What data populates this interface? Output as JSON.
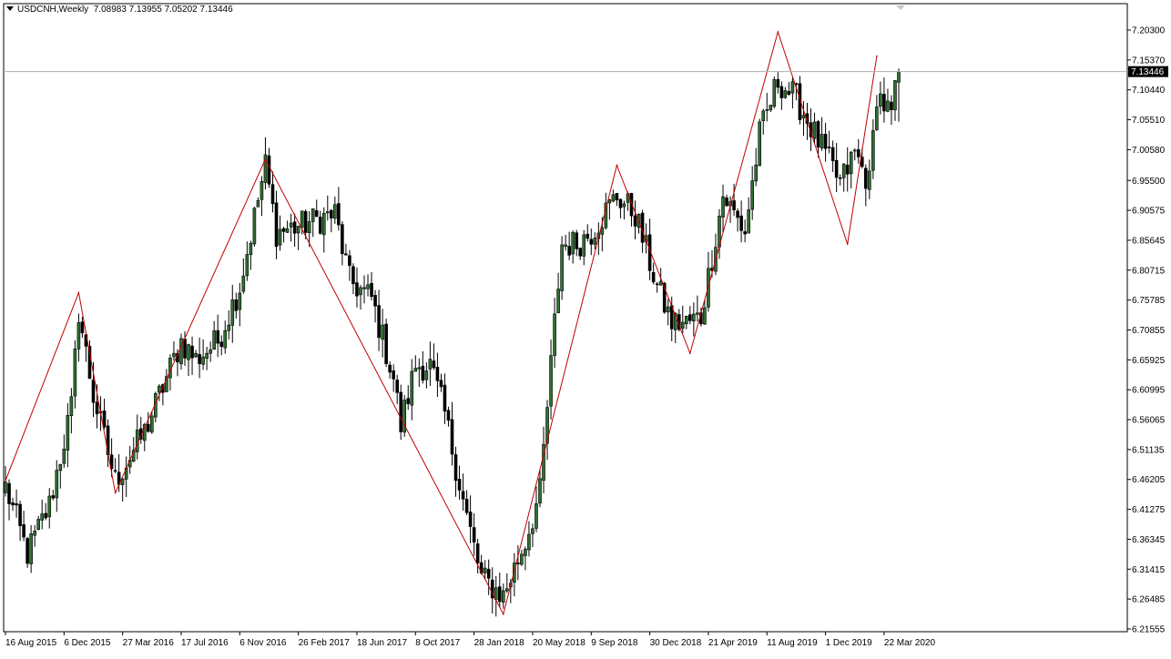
{
  "header": {
    "symbol_timeframe": "USDCNH,Weekly",
    "ohlc": "7.08983 7.13955 7.05202 7.13446"
  },
  "colors": {
    "bull_fill": "#2f6f2f",
    "bear_fill": "#000000",
    "zigzag": "#c00000",
    "grid_frame": "#000000",
    "price_line": "#b0b0b0",
    "price_label_bg": "#000000",
    "price_label_text": "#ffffff"
  },
  "chart_data": {
    "type": "candlestick",
    "symbol": "USDCNH",
    "timeframe": "Weekly",
    "current_price": "7.13446",
    "ylim": [
      6.21555,
      7.23
    ],
    "y_ticks": [
      "7.20300",
      "7.15370",
      "7.10440",
      "7.05510",
      "7.00580",
      "6.95500",
      "6.90575",
      "6.85645",
      "6.80715",
      "6.75785",
      "6.70855",
      "6.65925",
      "6.60995",
      "6.56065",
      "6.51135",
      "6.46205",
      "6.41275",
      "6.36345",
      "6.31415",
      "6.26485",
      "6.21555"
    ],
    "x_ticks": [
      "16 Aug 2015",
      "6 Dec 2015",
      "27 Mar 2016",
      "17 Jul 2016",
      "6 Nov 2016",
      "26 Feb 2017",
      "18 Jun 2017",
      "8 Oct 2017",
      "28 Jan 2018",
      "20 May 2018",
      "9 Sep 2018",
      "30 Dec 2018",
      "21 Apr 2019",
      "11 Aug 2019",
      "1 Dec 2019",
      "22 Mar 2020"
    ],
    "zigzag": [
      {
        "week": 0,
        "price": 6.46
      },
      {
        "week": 20,
        "price": 6.77
      },
      {
        "week": 30,
        "price": 6.44
      },
      {
        "week": 71,
        "price": 6.99
      },
      {
        "week": 136,
        "price": 6.24
      },
      {
        "week": 167,
        "price": 6.98
      },
      {
        "week": 187,
        "price": 6.67
      },
      {
        "week": 211,
        "price": 7.2
      },
      {
        "week": 230,
        "price": 6.85
      },
      {
        "week": 238,
        "price": 7.16
      }
    ],
    "anchors": [
      {
        "week": 0,
        "price": 6.45
      },
      {
        "week": 6,
        "price": 6.34
      },
      {
        "week": 12,
        "price": 6.42
      },
      {
        "week": 18,
        "price": 6.58
      },
      {
        "week": 20,
        "price": 6.74
      },
      {
        "week": 24,
        "price": 6.6
      },
      {
        "week": 30,
        "price": 6.46
      },
      {
        "week": 38,
        "price": 6.54
      },
      {
        "week": 48,
        "price": 6.69
      },
      {
        "week": 52,
        "price": 6.66
      },
      {
        "week": 58,
        "price": 6.69
      },
      {
        "week": 64,
        "price": 6.78
      },
      {
        "week": 71,
        "price": 6.98
      },
      {
        "week": 74,
        "price": 6.87
      },
      {
        "week": 80,
        "price": 6.88
      },
      {
        "week": 90,
        "price": 6.9
      },
      {
        "week": 94,
        "price": 6.79
      },
      {
        "week": 100,
        "price": 6.76
      },
      {
        "week": 106,
        "price": 6.63
      },
      {
        "week": 108,
        "price": 6.55
      },
      {
        "week": 112,
        "price": 6.65
      },
      {
        "week": 116,
        "price": 6.65
      },
      {
        "week": 120,
        "price": 6.57
      },
      {
        "week": 126,
        "price": 6.4
      },
      {
        "week": 130,
        "price": 6.3
      },
      {
        "week": 136,
        "price": 6.27
      },
      {
        "week": 142,
        "price": 6.36
      },
      {
        "week": 146,
        "price": 6.44
      },
      {
        "week": 150,
        "price": 6.72
      },
      {
        "week": 152,
        "price": 6.85
      },
      {
        "week": 156,
        "price": 6.85
      },
      {
        "week": 160,
        "price": 6.87
      },
      {
        "week": 167,
        "price": 6.93
      },
      {
        "week": 172,
        "price": 6.9
      },
      {
        "week": 178,
        "price": 6.78
      },
      {
        "week": 182,
        "price": 6.72
      },
      {
        "week": 186,
        "price": 6.72
      },
      {
        "week": 190,
        "price": 6.73
      },
      {
        "week": 196,
        "price": 6.93
      },
      {
        "week": 202,
        "price": 6.87
      },
      {
        "week": 206,
        "price": 7.03
      },
      {
        "week": 211,
        "price": 7.12
      },
      {
        "week": 216,
        "price": 7.09
      },
      {
        "week": 222,
        "price": 7.02
      },
      {
        "week": 228,
        "price": 6.95
      },
      {
        "week": 232,
        "price": 7.0
      },
      {
        "week": 236,
        "price": 6.95
      },
      {
        "week": 238,
        "price": 7.1
      },
      {
        "week": 242,
        "price": 7.06
      },
      {
        "week": 244,
        "price": 7.13446
      }
    ]
  }
}
